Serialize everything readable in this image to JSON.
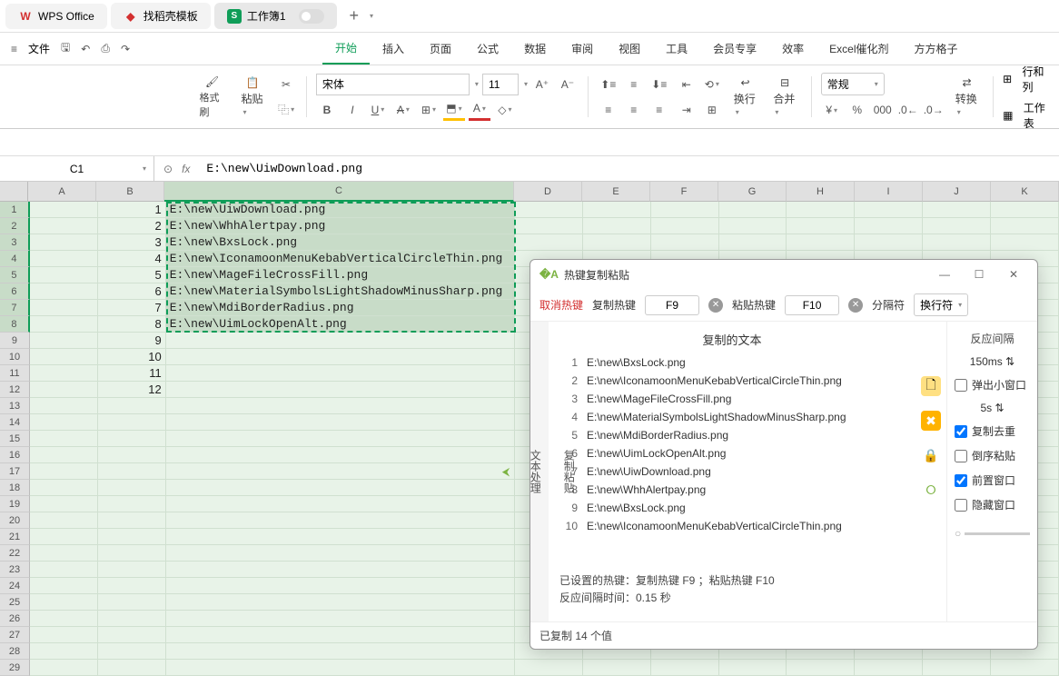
{
  "title_tabs": {
    "wps": "WPS Office",
    "template": "找稻壳模板",
    "workbook": "工作簿1"
  },
  "menu": {
    "file": "文件",
    "tabs": [
      "开始",
      "插入",
      "页面",
      "公式",
      "数据",
      "审阅",
      "视图",
      "工具",
      "会员专享",
      "效率",
      "Excel催化剂",
      "方方格子"
    ],
    "active_index": 0
  },
  "ribbon": {
    "format_brush": "格式刷",
    "paste": "粘贴",
    "font_name": "宋体",
    "font_size": "11",
    "wrap": "换行",
    "merge": "合并",
    "normal": "常规",
    "convert": "转换",
    "rows_cols": "行和列",
    "worksheet": "工作表"
  },
  "name_box": "C1",
  "formula": "E:\\new\\UiwDownload.png",
  "columns": [
    "A",
    "B",
    "C",
    "D",
    "E",
    "F",
    "G",
    "H",
    "I",
    "J",
    "K"
  ],
  "col_b_values": [
    "1",
    "2",
    "3",
    "4",
    "5",
    "6",
    "7",
    "8",
    "9",
    "10",
    "11",
    "12"
  ],
  "col_c_values": [
    "E:\\new\\UiwDownload.png",
    "E:\\new\\WhhAlertpay.png",
    "E:\\new\\BxsLock.png",
    "E:\\new\\IconamoonMenuKebabVerticalCircleThin.png",
    "E:\\new\\MageFileCrossFill.png",
    "E:\\new\\MaterialSymbolsLightShadowMinusSharp.png",
    "E:\\new\\MdiBorderRadius.png",
    "E:\\new\\UimLockOpenAlt.png"
  ],
  "dialog": {
    "title": "热键复制粘贴",
    "cancel_hotkey": "取消热键",
    "copy_label": "复制热键",
    "copy_key": "F9",
    "paste_label": "粘贴热键",
    "paste_key": "F10",
    "separator_label": "分隔符",
    "separator_value": "换行符",
    "side_tab1": "复制粘贴",
    "side_tab2": "文本处理",
    "copied_title": "复制的文本",
    "list": [
      "E:\\new\\BxsLock.png",
      "E:\\new\\IconamoonMenuKebabVerticalCircleThin.png",
      "E:\\new\\MageFileCrossFill.png",
      "E:\\new\\MaterialSymbolsLightShadowMinusSharp.png",
      "E:\\new\\MdiBorderRadius.png",
      "E:\\new\\UimLockOpenAlt.png",
      "E:\\new\\UiwDownload.png",
      "E:\\new\\WhhAlertpay.png",
      "E:\\new\\BxsLock.png",
      "E:\\new\\IconamoonMenuKebabVerticalCircleThin.png"
    ],
    "status1": "已设置的热键：复制热键 F9 ；粘贴热键 F10",
    "status2": "反应间隔时间：0.15 秒",
    "right": {
      "interval_label": "反应间隔",
      "interval_value": "150ms",
      "popup": "弹出小窗口",
      "popup_time": "5s",
      "dedupe": "复制去重",
      "reverse": "倒序粘贴",
      "front": "前置窗口",
      "hide": "隐藏窗口"
    },
    "footer": "已复制 14 个值"
  }
}
